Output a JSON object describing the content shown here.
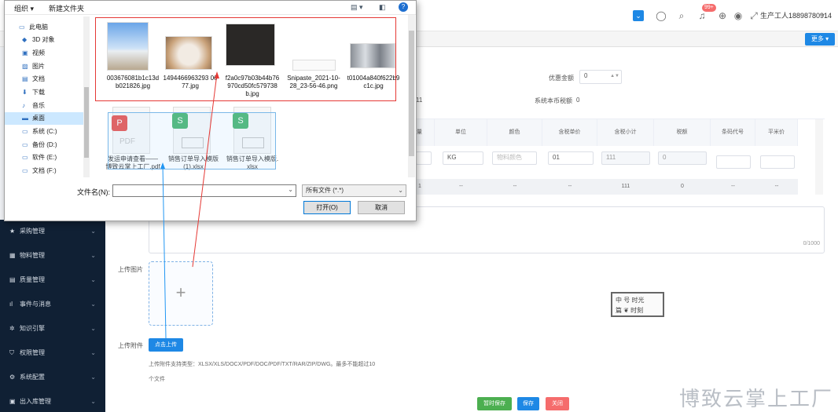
{
  "header": {
    "badge": "99+",
    "user": "生产工人18898780914"
  },
  "subbar": {
    "more": "更多"
  },
  "sidebar": {
    "items": [
      "采购管理",
      "物料管理",
      "质量管理",
      "事件与消息",
      "知识引擎",
      "权限管理",
      "系统配置",
      "出入库管理"
    ]
  },
  "form": {
    "discount_label": "优惠金额",
    "discount_value": "0",
    "tax_label": "系统本币税额",
    "tax_value": "0",
    "partial_value": "11",
    "columns": [
      "量",
      "单位",
      "颜色",
      "含税单价",
      "含税小计",
      "税额",
      "条码代号",
      "平米价"
    ],
    "row": {
      "unit": "KG",
      "color_placeholder": "物料颜色",
      "price": "01",
      "subtotal": "111",
      "tax": "0"
    },
    "summary": [
      "1",
      "--",
      "--",
      "--",
      "111",
      "0",
      "--",
      "--"
    ],
    "remark_counter": "0/1000",
    "image_label": "上传图片",
    "attach_label": "上传附件",
    "upload_btn": "点击上传",
    "hint": "上传附件支持类型：XLSX/XLS/DOCX/PDF/DOC/PDF/TXT/RAR/ZIP/DWG。最多不能超过10",
    "hint2": "个文件",
    "stamp_l1": "中 号 时光",
    "stamp_l2": "篇 ❦ 时刻",
    "btn_save_temp": "暂时保存",
    "btn_save": "保存",
    "btn_close": "关闭",
    "watermark": "博致云掌上工厂"
  },
  "dialog": {
    "organize": "组织 ▾",
    "new_folder": "新建文件夹",
    "nav": [
      "此电脑",
      "3D 对象",
      "视频",
      "图片",
      "文档",
      "下载",
      "音乐",
      "桌面",
      "系统 (C:)",
      "备份 (D:)",
      "软件 (E:)",
      "文档 (F:)"
    ],
    "files": [
      "003676081b1c13db021826.jpg",
      "1494466963293 0677.jpg",
      "f2a0c97b03b44b76970cd50fc579738b.jpg",
      "Snipaste_2021-10-28_23-56-46.png",
      "t01004a840f622b9c1c.jpg",
      "发运申请查看——博致云掌上工厂.pdf",
      "销售订单导入模版 (1).xlsx",
      "销售订单导入模版.xlsx"
    ],
    "filename_label": "文件名(N):",
    "filetype": "所有文件 (*.*)",
    "open": "打开(O)",
    "cancel": "取消"
  }
}
